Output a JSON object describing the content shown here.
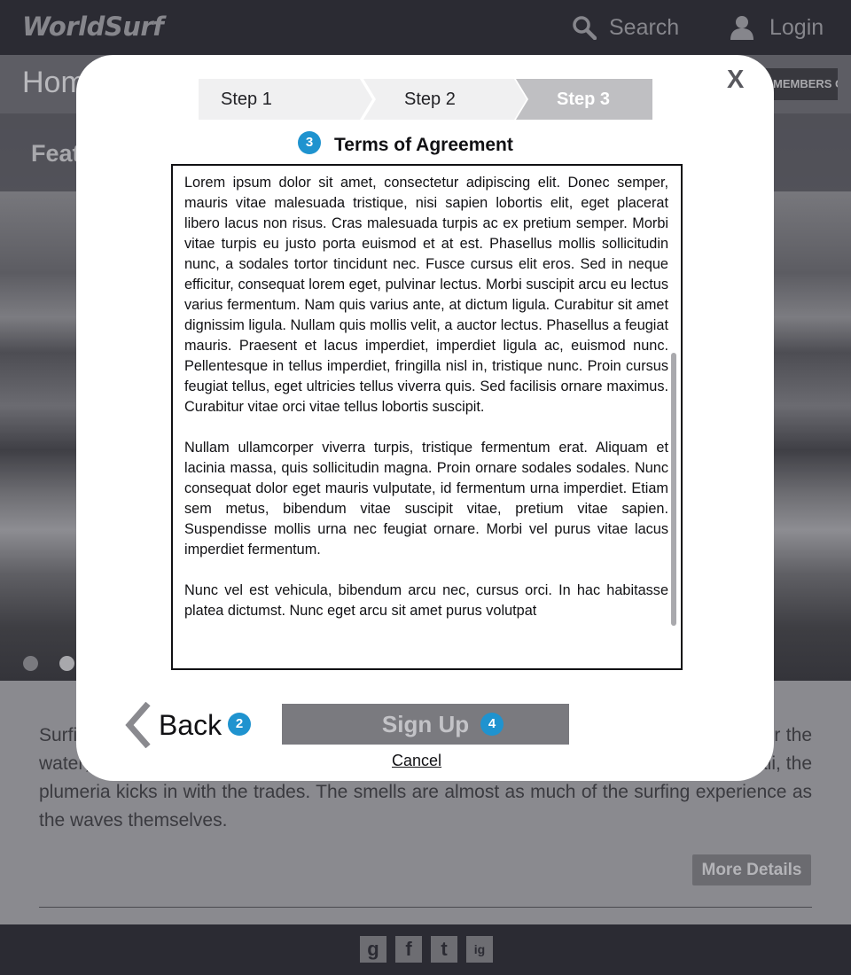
{
  "header": {
    "logo": "WorldSurf",
    "search_label": "Search",
    "login_label": "Login"
  },
  "titlebar": {
    "title": "Home",
    "members_badge": "MEMBERS ONLY"
  },
  "hero": {
    "title": "Featured"
  },
  "body": {
    "text": "Surfing is a sensory experience. In Southern California, the smell of sagebrush drifts over the water; in Northern California, the smell of eucalyptus wafts out to the lineup and in Hawaii, the plumeria kicks in with the trades. The smells are almost as much of the surfing experience as the waves themselves.",
    "more_button": "More Details"
  },
  "footer": {
    "social": [
      "g",
      "f",
      "t",
      "ig"
    ]
  },
  "modal": {
    "close_label": "X",
    "steps": [
      {
        "label": "Step 1",
        "active": false
      },
      {
        "label": "Step 2",
        "active": false
      },
      {
        "label": "Step 3",
        "active": true
      }
    ],
    "terms_badge": "3",
    "terms_title": "Terms of Agreement",
    "terms_paragraphs": [
      "Lorem ipsum dolor sit amet, consectetur adipiscing elit. Donec semper, mauris vitae malesuada tristique, nisi sapien lobortis elit, eget placerat libero lacus non risus. Cras malesuada turpis ac ex pretium semper. Morbi vitae turpis eu justo porta euismod et at est. Phasellus mollis sollicitudin nunc, a sodales tortor tincidunt nec. Fusce cursus elit eros. Sed in neque efficitur, consequat lorem eget, pulvinar lectus. Morbi suscipit arcu eu lectus varius fermentum. Nam quis varius ante, at dictum ligula. Curabitur sit amet dignissim ligula. Nullam quis mollis velit, a auctor lectus. Phasellus a feugiat mauris. Praesent et lacus imperdiet, imperdiet ligula ac, euismod nunc. Pellentesque in tellus imperdiet, fringilla nisl in, tristique nunc. Proin cursus feugiat tellus, eget ultricies tellus viverra quis. Sed facilisis ornare maximus. Curabitur vitae orci vitae tellus lobortis suscipit.",
      "Nullam ullamcorper viverra turpis, tristique fermentum erat. Aliquam et lacinia massa, quis sollicitudin magna. Proin ornare sodales sodales. Nunc consequat dolor eget mauris vulputate, id fermentum urna imperdiet. Etiam sem metus, bibendum vitae suscipit vitae, pretium vitae sapien. Suspendisse mollis urna nec feugiat ornare. Morbi vel purus vitae lacus imperdiet fermentum.",
      "Nunc vel est vehicula, bibendum arcu nec, cursus orci. In hac habitasse platea dictumst. Nunc eget arcu sit amet purus volutpat"
    ],
    "back_label": "Back",
    "back_badge": "2",
    "signup_label": "Sign Up",
    "signup_badge": "4",
    "cancel_label": "Cancel"
  },
  "colors": {
    "accent_badge": "#1f93cf",
    "header_bg": "#2b2b33"
  }
}
